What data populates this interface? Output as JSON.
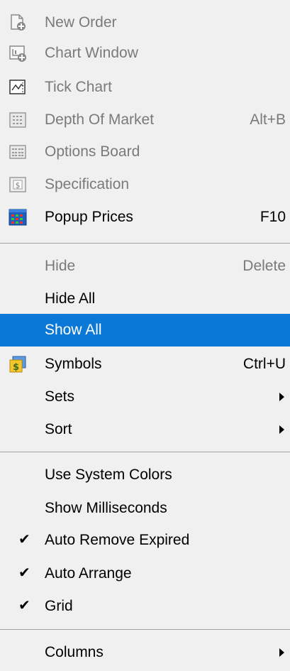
{
  "menu": {
    "new_order": {
      "label": "New Order"
    },
    "chart_window": {
      "label": "Chart Window"
    },
    "tick_chart": {
      "label": "Tick Chart"
    },
    "depth_of_market": {
      "label": "Depth Of Market",
      "shortcut": "Alt+B"
    },
    "options_board": {
      "label": "Options Board"
    },
    "specification": {
      "label": "Specification"
    },
    "popup_prices": {
      "label": "Popup Prices",
      "shortcut": "F10"
    },
    "hide": {
      "label": "Hide",
      "shortcut": "Delete"
    },
    "hide_all": {
      "label": "Hide All"
    },
    "show_all": {
      "label": "Show All"
    },
    "symbols": {
      "label": "Symbols",
      "shortcut": "Ctrl+U"
    },
    "sets": {
      "label": "Sets"
    },
    "sort": {
      "label": "Sort"
    },
    "use_system_colors": {
      "label": "Use System Colors"
    },
    "show_milliseconds": {
      "label": "Show Milliseconds"
    },
    "auto_remove_expired": {
      "label": "Auto Remove Expired",
      "checked": true
    },
    "auto_arrange": {
      "label": "Auto Arrange",
      "checked": true
    },
    "grid": {
      "label": "Grid",
      "checked": true
    },
    "columns": {
      "label": "Columns"
    }
  },
  "icons": {
    "new_order": "new-order-icon",
    "chart_window": "chart-window-icon",
    "tick_chart": "tick-chart-icon",
    "depth_of_market": "depth-of-market-icon",
    "options_board": "options-board-icon",
    "specification": "specification-icon",
    "popup_prices": "popup-prices-icon",
    "symbols": "symbols-icon"
  },
  "colors": {
    "menu_background": "#f0f0f0",
    "highlight": "#0a78d7",
    "disabled_text": "#7a7a7a",
    "separator": "#a0a0a0"
  }
}
